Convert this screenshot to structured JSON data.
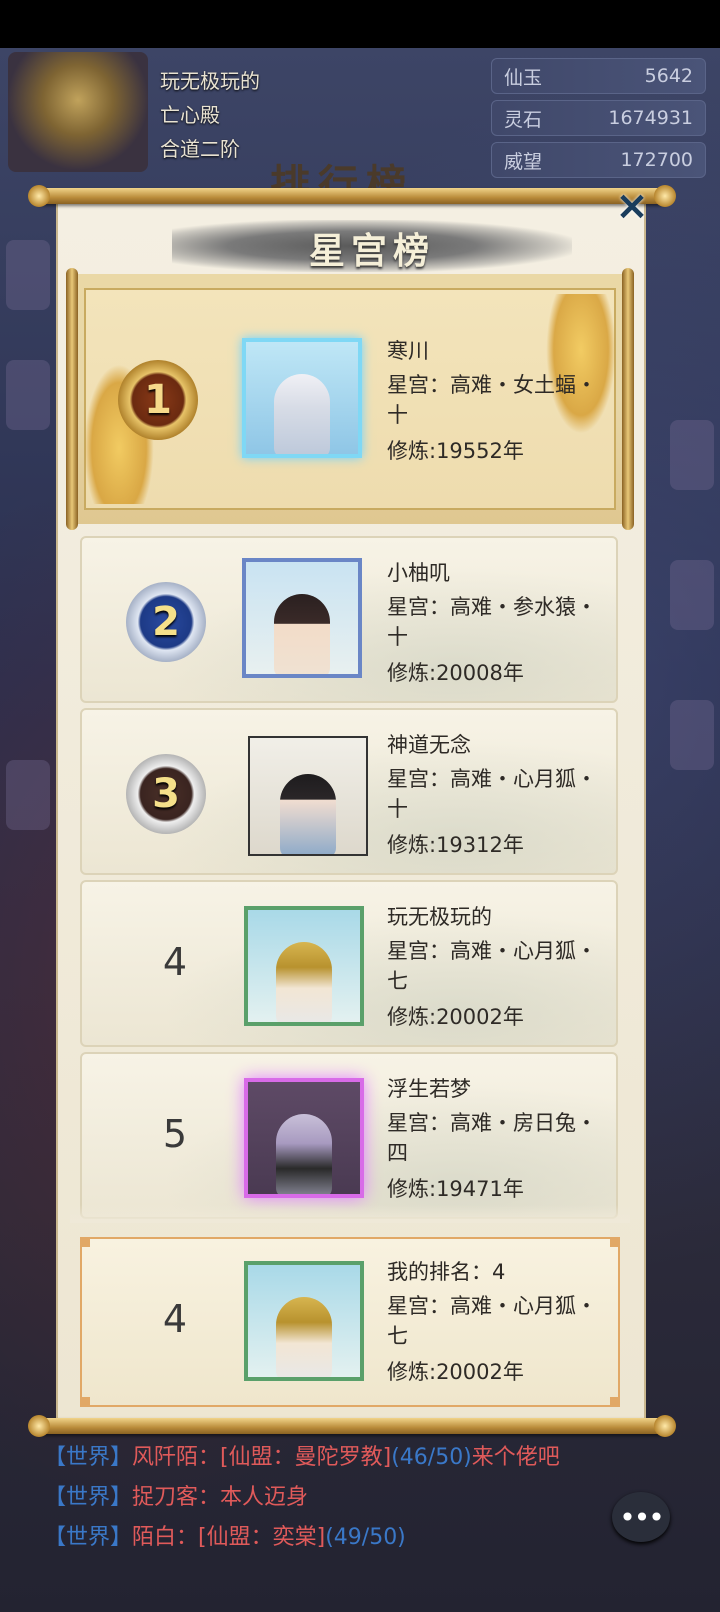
{
  "player": {
    "name": "玩无极玩的",
    "sect": "亡心殿",
    "realm": "合道二阶"
  },
  "currency": [
    {
      "label": "仙玉",
      "value": "5642"
    },
    {
      "label": "灵石",
      "value": "1674931"
    },
    {
      "label": "威望",
      "value": "172700"
    }
  ],
  "background_title": "排行榜",
  "panel": {
    "title": "星宫榜",
    "close_icon": "×"
  },
  "ranking": [
    {
      "rank": "1",
      "name": "寒川",
      "star": "星宫：高难・女土蝠・十",
      "cult": "修炼:19552年",
      "frame": "ice"
    },
    {
      "rank": "2",
      "name": "小柚叽",
      "star": "星宫：高难・参水猿・十",
      "cult": "修炼:20008年",
      "frame": "blossom"
    },
    {
      "rank": "3",
      "name": "神道无念",
      "star": "星宫：高难・心月狐・十",
      "cult": "修炼:19312年",
      "frame": "plain"
    },
    {
      "rank": "4",
      "name": "玩无极玩的",
      "star": "星宫：高难・心月狐・七",
      "cult": "修炼:20002年",
      "frame": "vine"
    },
    {
      "rank": "5",
      "name": "浮生若梦",
      "star": "星宫：高难・房日兔・四",
      "cult": "修炼:19471年",
      "frame": "purple"
    }
  ],
  "my_rank": {
    "rank": "4",
    "name": "我的排名：4",
    "star": "星宫：高难・心月狐・七",
    "cult": "修炼:20002年"
  },
  "chat": [
    {
      "channel": "【世界】",
      "speaker": "风阡陌：",
      "msg": "[仙盟：曼陀罗教]",
      "sub": "(46/50)",
      "tail": "来个佬吧"
    },
    {
      "channel": "【世界】",
      "speaker": "捉刀客：",
      "msg": "本人迈身",
      "sub": "",
      "tail": ""
    },
    {
      "channel": "【世界】",
      "speaker": "陌白：",
      "msg": "[仙盟：奕棠]",
      "sub": "(49/50)",
      "tail": ""
    }
  ],
  "chat_button_icon": "•••"
}
